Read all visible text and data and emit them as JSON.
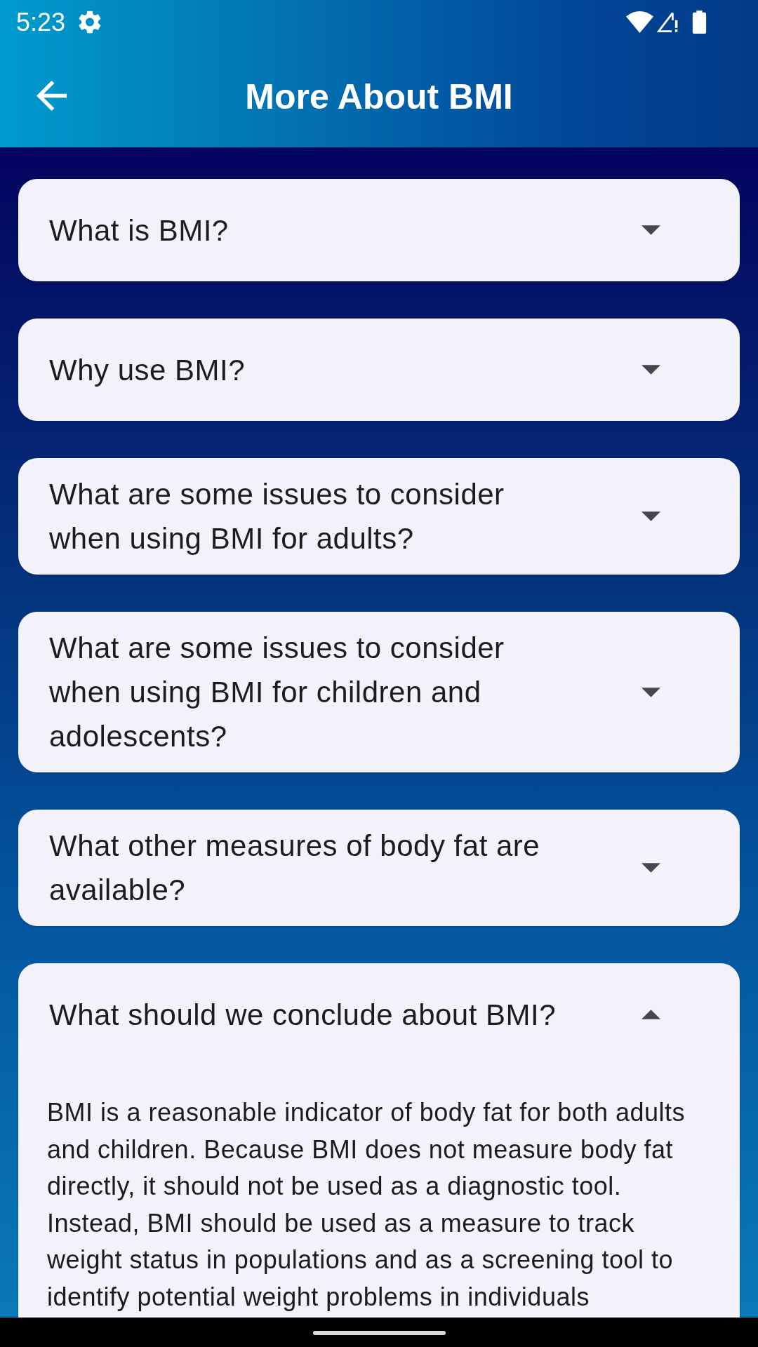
{
  "status_bar": {
    "time": "5:23"
  },
  "app_bar": {
    "title": "More About BMI"
  },
  "faq_items": [
    {
      "question": "What is BMI?",
      "expanded": false
    },
    {
      "question": "Why use BMI?",
      "expanded": false
    },
    {
      "question": "What are some issues to consider when using BMI for adults?",
      "expanded": false
    },
    {
      "question": "What are some issues to consider when using BMI for children and adolescents?",
      "expanded": false
    },
    {
      "question": "What other measures of body fat are available?",
      "expanded": false
    },
    {
      "question": "What should we conclude about BMI?",
      "expanded": true,
      "answer": "BMI is a reasonable indicator of body fat for both adults and children. Because BMI does not measure body fat directly, it should not be used as a diagnostic tool. Instead, BMI should be used as a measure to track weight status in populations and as a screening tool to identify potential weight problems in individuals"
    }
  ]
}
